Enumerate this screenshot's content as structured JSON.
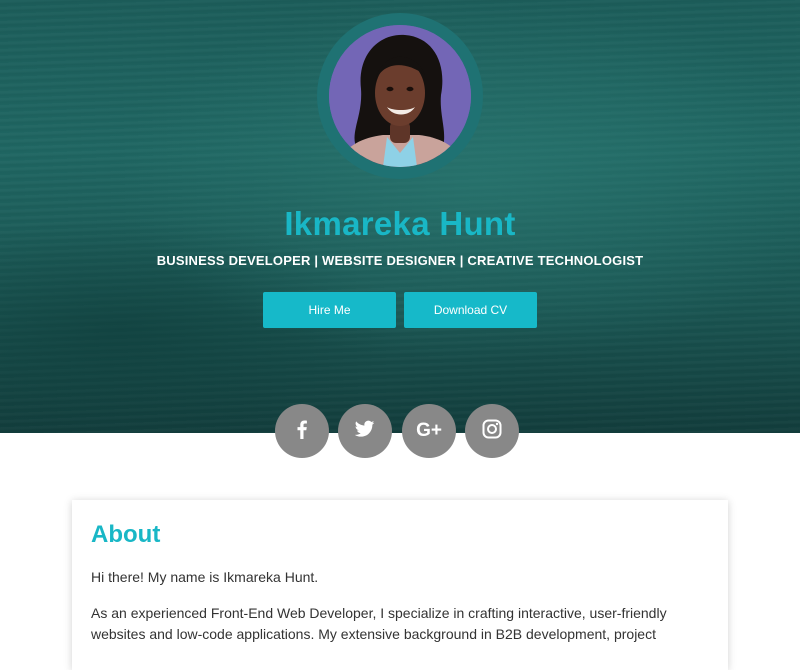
{
  "hero": {
    "name": "Ikmareka Hunt",
    "tagline": "BUSINESS DEVELOPER | WEBSITE DESIGNER | CREATIVE TECHNOLOGIST",
    "hire_label": "Hire Me",
    "cv_label": "Download CV"
  },
  "social": {
    "facebook_icon": "facebook-icon",
    "twitter_icon": "twitter-icon",
    "googleplus_label": "G+",
    "instagram_icon": "instagram-icon"
  },
  "about": {
    "heading": "About",
    "intro": "Hi there! My name is Ikmareka Hunt.",
    "body": "As an experienced Front-End Web Developer, I specialize in crafting interactive, user-friendly websites and low-code applications. My extensive background in B2B development, project"
  },
  "colors": {
    "accent": "#19b7c6",
    "button": "#16b9c9",
    "social_bg": "#888888",
    "hero_bg": "#1c5d5a"
  }
}
